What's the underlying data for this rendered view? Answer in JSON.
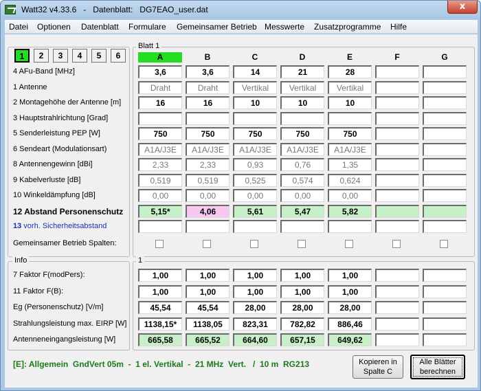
{
  "window": {
    "title": "Watt32 v4.33.6   -   Datenblatt:   DG7EAO_user.dat",
    "close_glyph": "x"
  },
  "menu": [
    "Datei",
    "Optionen",
    "Datenblatt",
    "Formulare",
    "Gemeinsamer Betrieb",
    "Messwerte",
    "Zusatzprogramme",
    "Hilfe"
  ],
  "tabs": [
    "1",
    "2",
    "3",
    "4",
    "5",
    "6"
  ],
  "active_tab": "1",
  "blatt_title": "Blatt 1",
  "info_title": "Info",
  "info_col_title": "1",
  "columns": [
    "A",
    "B",
    "C",
    "D",
    "E",
    "F",
    "G"
  ],
  "rows": [
    {
      "label": "4  AFu-Band [MHz]",
      "values": [
        "3,6",
        "3,6",
        "14",
        "21",
        "28",
        "",
        ""
      ],
      "style": "bold"
    },
    {
      "label": "1  Antenne",
      "values": [
        "Draht",
        "Draht",
        "Vertikal",
        "Vertikal",
        "Vertikal",
        "",
        ""
      ],
      "style": "gray"
    },
    {
      "label": "2  Montagehöhe der Antenne [m]",
      "values": [
        "16",
        "16",
        "10",
        "10",
        "10",
        "",
        ""
      ],
      "style": "bold"
    },
    {
      "label": "3  Hauptstrahlrichtung [Grad]",
      "values": [
        "",
        "",
        "",
        "",
        "",
        "",
        ""
      ],
      "style": "bold"
    },
    {
      "label": "5  Senderleistung PEP [W]",
      "values": [
        "750",
        "750",
        "750",
        "750",
        "750",
        "",
        ""
      ],
      "style": "bold"
    },
    {
      "label": "6  Sendeart (Modulationsart)",
      "values": [
        "A1A/J3E",
        "A1A/J3E",
        "A1A/J3E",
        "A1A/J3E",
        "A1A/J3E",
        "",
        ""
      ],
      "style": "gray"
    },
    {
      "label": "8  Antennengewinn [dBi]",
      "values": [
        "2,33",
        "2,33",
        "0,93",
        "0,76",
        "1,35",
        "",
        ""
      ],
      "style": "gray"
    },
    {
      "label": "9  Kabelverluste [dB]",
      "values": [
        "0,519",
        "0,519",
        "0,525",
        "0,574",
        "0,624",
        "",
        ""
      ],
      "style": "gray"
    },
    {
      "label": "10 Winkeldämpfung [dB]",
      "values": [
        "0,00",
        "0,00",
        "0,00",
        "0,00",
        "0,00",
        "",
        ""
      ],
      "style": "gray"
    },
    {
      "label": "12 Abstand Personenschutz",
      "values": [
        "5,15*",
        "4,06",
        "5,61",
        "5,47",
        "5,82",
        "",
        ""
      ],
      "style": "result"
    },
    {
      "label_num": "13",
      "label_text": " vorh. Sicherheitsabstand",
      "values": [
        "",
        "",
        "",
        "",
        "",
        "",
        ""
      ],
      "style": "blue"
    }
  ],
  "gemeinsamer_label": "Gemeinsamer Betrieb Spalten:",
  "info_rows": [
    {
      "label": "7 Faktor F(modPers):",
      "values": [
        "1,00",
        "1,00",
        "1,00",
        "1,00",
        "1,00",
        "",
        ""
      ],
      "style": "bold"
    },
    {
      "label": "11  Faktor F(B):",
      "values": [
        "1,00",
        "1,00",
        "1,00",
        "1,00",
        "1,00",
        "",
        ""
      ],
      "style": "bold"
    },
    {
      "label": "Eg (Personenschutz) [V/m]",
      "values": [
        "45,54",
        "45,54",
        "28,00",
        "28,00",
        "28,00",
        "",
        ""
      ],
      "style": "bold"
    },
    {
      "label": "Strahlungsleistung max. EIRP [W]",
      "values": [
        "1138,15*",
        "1138,05",
        "823,31",
        "782,82",
        "886,46",
        "",
        ""
      ],
      "style": "bold"
    },
    {
      "label": "Antenneneingangsleistung [W]",
      "values": [
        "665,58",
        "665,52",
        "664,60",
        "657,15",
        "649,62",
        "",
        ""
      ],
      "style": "green"
    }
  ],
  "status": "[E]: Allgemein  GndVert 05m  -  1 el. Vertikal  -  21 MHz  Vert.   /  10 m  RG213",
  "buttons": {
    "copy_line1": "Kopieren in",
    "copy_line2": "Spalte C",
    "calc_line1": "Alle Blätter",
    "calc_line2": "berechnen"
  },
  "colors": {
    "active_green": "#22dd22",
    "result_green": "#c8f0c8",
    "result_pink": "#f8c8f0",
    "status_green": "#1b7a1b",
    "link_blue": "#1a2fb5"
  }
}
